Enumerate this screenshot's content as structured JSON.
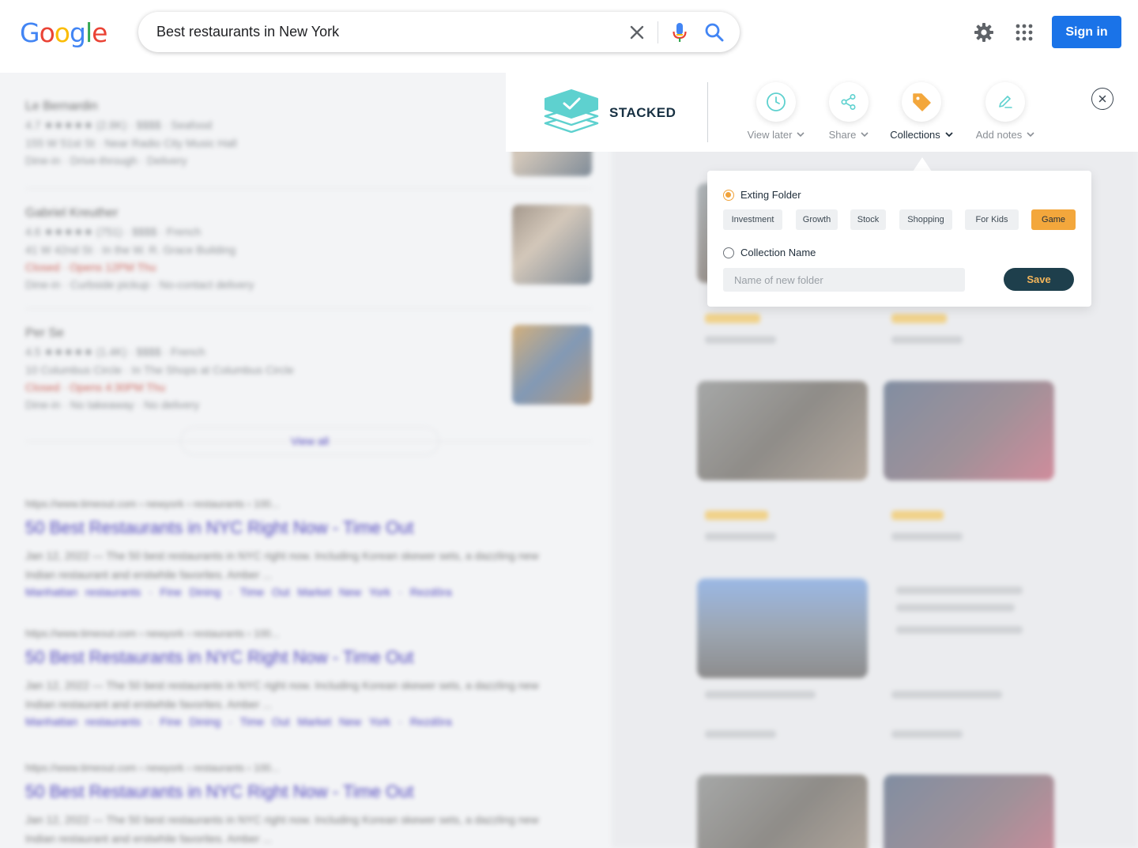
{
  "search": {
    "query": "Best restaurants in New York"
  },
  "header": {
    "logo_letters": [
      {
        "char": "G",
        "color": "#4285F4"
      },
      {
        "char": "o",
        "color": "#EA4335"
      },
      {
        "char": "o",
        "color": "#FBBC05"
      },
      {
        "char": "g",
        "color": "#4285F4"
      },
      {
        "char": "l",
        "color": "#34A853"
      },
      {
        "char": "e",
        "color": "#EA4335"
      }
    ],
    "signin_label": "Sign in"
  },
  "background": {
    "places": [
      {
        "name": "Le Bernardin",
        "rating_line": "4.7 ★★★★★ (2.8K) · $$$$ · Seafood",
        "address": "155 W 51st St · Near Radio City Music Hall",
        "status": "",
        "extra": "Dine-in · Drive-through · Delivery"
      },
      {
        "name": "Gabriel Kreuther",
        "rating_line": "4.6 ★★★★★ (751) · $$$$ · French",
        "address": "41 W 42nd St · In the W. R. Grace Building",
        "status": "Closed · Opens 12PM Thu",
        "extra": "Dine-in · Curbside pickup · No-contact delivery"
      },
      {
        "name": "Per Se",
        "rating_line": "4.5 ★★★★★ (1.4K) · $$$$ · French",
        "address": "10 Columbus Circle · In The Shops at Columbus Circle",
        "status": "Closed · Opens 4:30PM Thu",
        "extra": "Dine-in · No takeaway · No delivery"
      }
    ],
    "view_all": "View all",
    "web_results": [
      {
        "url": "https://www.timeout.com › newyork › restaurants › 100...",
        "title": "50 Best Restaurants in NYC Right Now - Time Out",
        "snippet": "Jan 12, 2022 — The 50 best restaurants in NYC right now. Including Korean skewer sets, a dazzling new Indian restaurant and erstwhile favorites. Amber ...",
        "links": "Manhattan restaurants · Fine Dining · Time Out Market New York · Rezdôra"
      },
      {
        "url": "https://www.timeout.com › newyork › restaurants › 100...",
        "title": "50 Best Restaurants in NYC Right Now - Time Out",
        "snippet": "Jan 12, 2022 — The 50 best restaurants in NYC right now. Including Korean skewer sets, a dazzling new Indian restaurant and erstwhile favorites. Amber ...",
        "links": "Manhattan restaurants · Fine Dining · Time Out Market New York · Rezdôra"
      },
      {
        "url": "https://www.timeout.com › newyork › restaurants › 100...",
        "title": "50 Best Restaurants in NYC Right Now - Time Out",
        "snippet": "Jan 12, 2022 — The 50 best restaurants in NYC right now. Including Korean skewer sets, a dazzling new Indian restaurant and erstwhile favorites. Amber ...",
        "links": ""
      }
    ]
  },
  "extension": {
    "brand": "STACKED",
    "tools": {
      "view_later": "View later",
      "share": "Share",
      "collections": "Collections",
      "add_notes": "Add notes"
    },
    "accent_color": "#f3a73c",
    "brand_color": "#5ed1cf"
  },
  "collections": {
    "existing_label": "Exting Folder",
    "folders": [
      "Investment",
      "Growth",
      "Stock",
      "Shopping",
      "For Kids",
      "Game"
    ],
    "selected_folder": "Game",
    "new_label": "Collection Name",
    "new_placeholder": "Name of new folder",
    "save_label": "Save"
  }
}
